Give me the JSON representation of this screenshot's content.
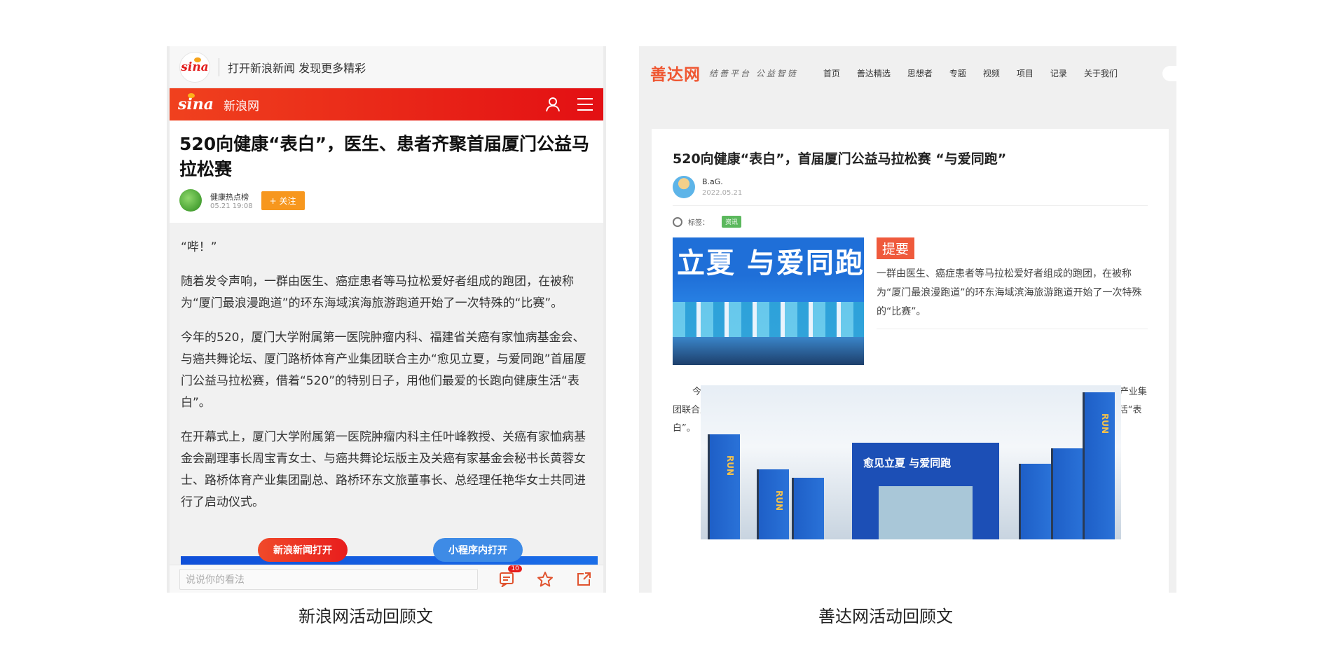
{
  "left": {
    "top_logo": "sina",
    "top_slogan": "打开新浪新闻 发现更多精彩",
    "bar_logo": "sina",
    "bar_site_name": "新浪网",
    "title": "520向健康“表白”，医生、患者齐聚首届厦门公益马拉松赛",
    "author_name": "健康热点榜",
    "author_time": "05.21 19:08",
    "follow_label": "+ 关注",
    "paragraphs": [
      "“哔！”",
      "随着发令声响，一群由医生、癌症患者等马拉松爱好者组成的跑团，在被称为“厦门最浪漫跑道”的环东海域滨海旅游跑道开始了一次特殊的“比赛”。",
      "今年的520，厦门大学附属第一医院肿瘤内科、福建省关癌有家恤病基金会、与癌共舞论坛、厦门路桥体育产业集团联合主办“愈见立夏，与爱同跑”首届厦门公益马拉松赛，借着“520”的特别日子，用他们最爱的长跑向健康生活“表白”。",
      "在开幕式上，厦门大学附属第一医院肿瘤内科主任叶峰教授、关癌有家恤病基金会副理事长周宝青女士、与癌共舞论坛版主及关癌有家基金会秘书长黄蓉女士、路桥体育产业集团副总、路桥环东文旅董事长、总经理任艳华女士共同进行了启动仪式。"
    ],
    "open_app_label": "新浪新闻打开",
    "mini_program_label": "小程序内打开",
    "comment_placeholder": "说说你的看法",
    "comment_count": "10",
    "caption": "新浪网活动回顾文"
  },
  "right": {
    "logo": "善达网",
    "tagline": "结善平台 公益智链",
    "menu": [
      "首页",
      "善达精选",
      "思想者",
      "专题",
      "视频",
      "项目",
      "记录",
      "关于我们"
    ],
    "title": "520向健康“表白”，首届厦门公益马拉松赛 “与爱同跑”",
    "author_name": "B.aG.",
    "author_date": "2022.05.21",
    "tags_label": "标签：",
    "tag": "资讯",
    "photo_banner_text": "立夏 与爱同跑",
    "summary_label": "提要",
    "summary_text": "一群由医生、癌症患者等马拉松爱好者组成的跑团，在被称为“厦门最浪漫跑道”的环东海域滨海旅游跑道开始了一次特殊的“比赛”。",
    "paragraph": "今年的520，厦门大学附属第一医院肿瘤内科、福建省关癌有家恤病基金会、与癌共舞论坛、厦门路桥体育产业集团联合主办“愈见立夏，与爱同跑”首届厦门公益马拉松赛，借着“520”的特别日子，用他们最爱的长跑向健康生活“表白”。",
    "gate_text": "愈见立夏 与爱同跑",
    "caption": "善达网活动回顾文"
  },
  "colors": {
    "sina_red": "#e30f13",
    "shanda_orange": "#ef5631",
    "tag_green": "#5bb85d"
  }
}
